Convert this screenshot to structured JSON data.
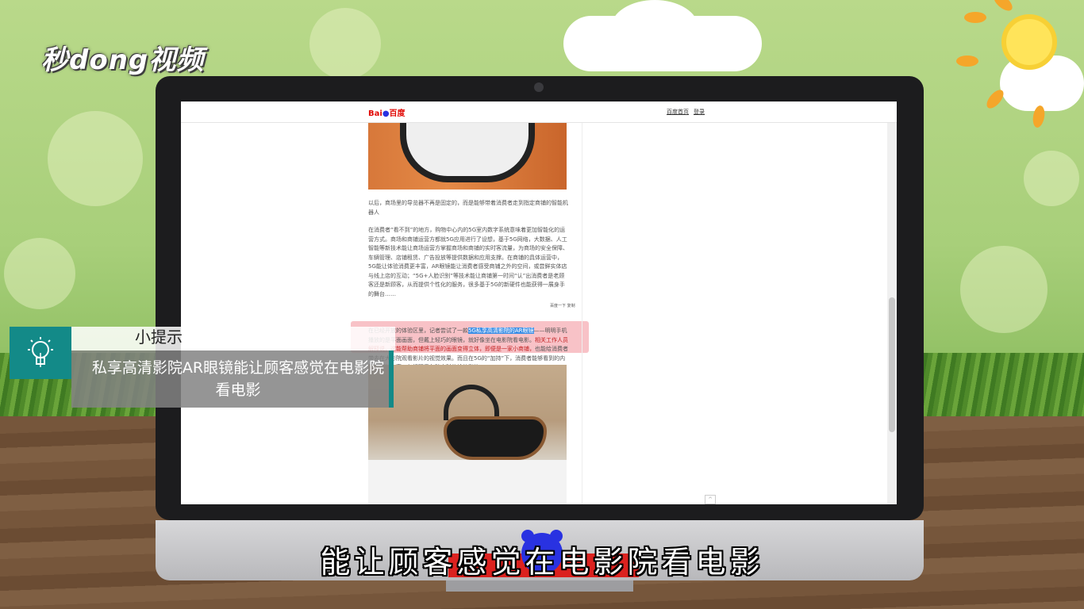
{
  "watermark": {
    "brand": "秒dong视频"
  },
  "browser": {
    "logo_text_left": "Bai",
    "logo_paw": "●",
    "logo_text_right": "百度",
    "top_links": [
      "百度首页",
      "登录"
    ]
  },
  "article": {
    "para1": "以后，商场里的导览器不再是固定的，而是能够带着消费者走到指定商铺的智能机器人",
    "para2": "在消费者“看不到”的地方，购物中心内的5G室内数字系统意味着更加智能化的运营方式。商场和商铺运营方都就5G应用进行了设想，基于5G网络，大数据、人工智能等新技术能让商场运营方掌握商场和商铺的实时客流量，为商场的安全保障、车辆管理、店铺租赁、广告投放等提供数据和应用支撑。在商铺的具体运营中，5G能让体验消费更丰富，AR眼镜能让消费者感受商铺之外的空间，或尝鲜实体店与线上店的互动；“5G+人脸识别”等技术能让商铺第一时间“认”出消费者是老顾客还是新顾客，从而提供个性化的服务，很多基于5G的新硬件也能获得一展身手的舞台……",
    "para3_start": "在已经开放的体验区里，记者尝试了一款",
    "para3_selected": "5G私享高清影院的AR眼镜",
    "para3_mid": "——明明手机播放的是平面画面，但戴上轻巧的眼镜，就好像坐在电影院看电影。",
    "para3_red": "相关工作人员解释说，这能帮助商铺将平面的画面变得立体，即便是一家小商铺，",
    "para3_end": "也能给消费者带去在大影院观看影片的视觉效果。而且在5G的“加持”下，消费者能够看到的内容会更加丰富，包括观看各种实时传输的影片。",
    "popup_tools": "百度一下  复制"
  },
  "tip": {
    "title": "小提示",
    "body": "私享高清影院AR眼镜能让顾客感觉在电影院看电影"
  },
  "subtitle": "能让顾客感觉在电影院看电影",
  "back_to_top": "^"
}
